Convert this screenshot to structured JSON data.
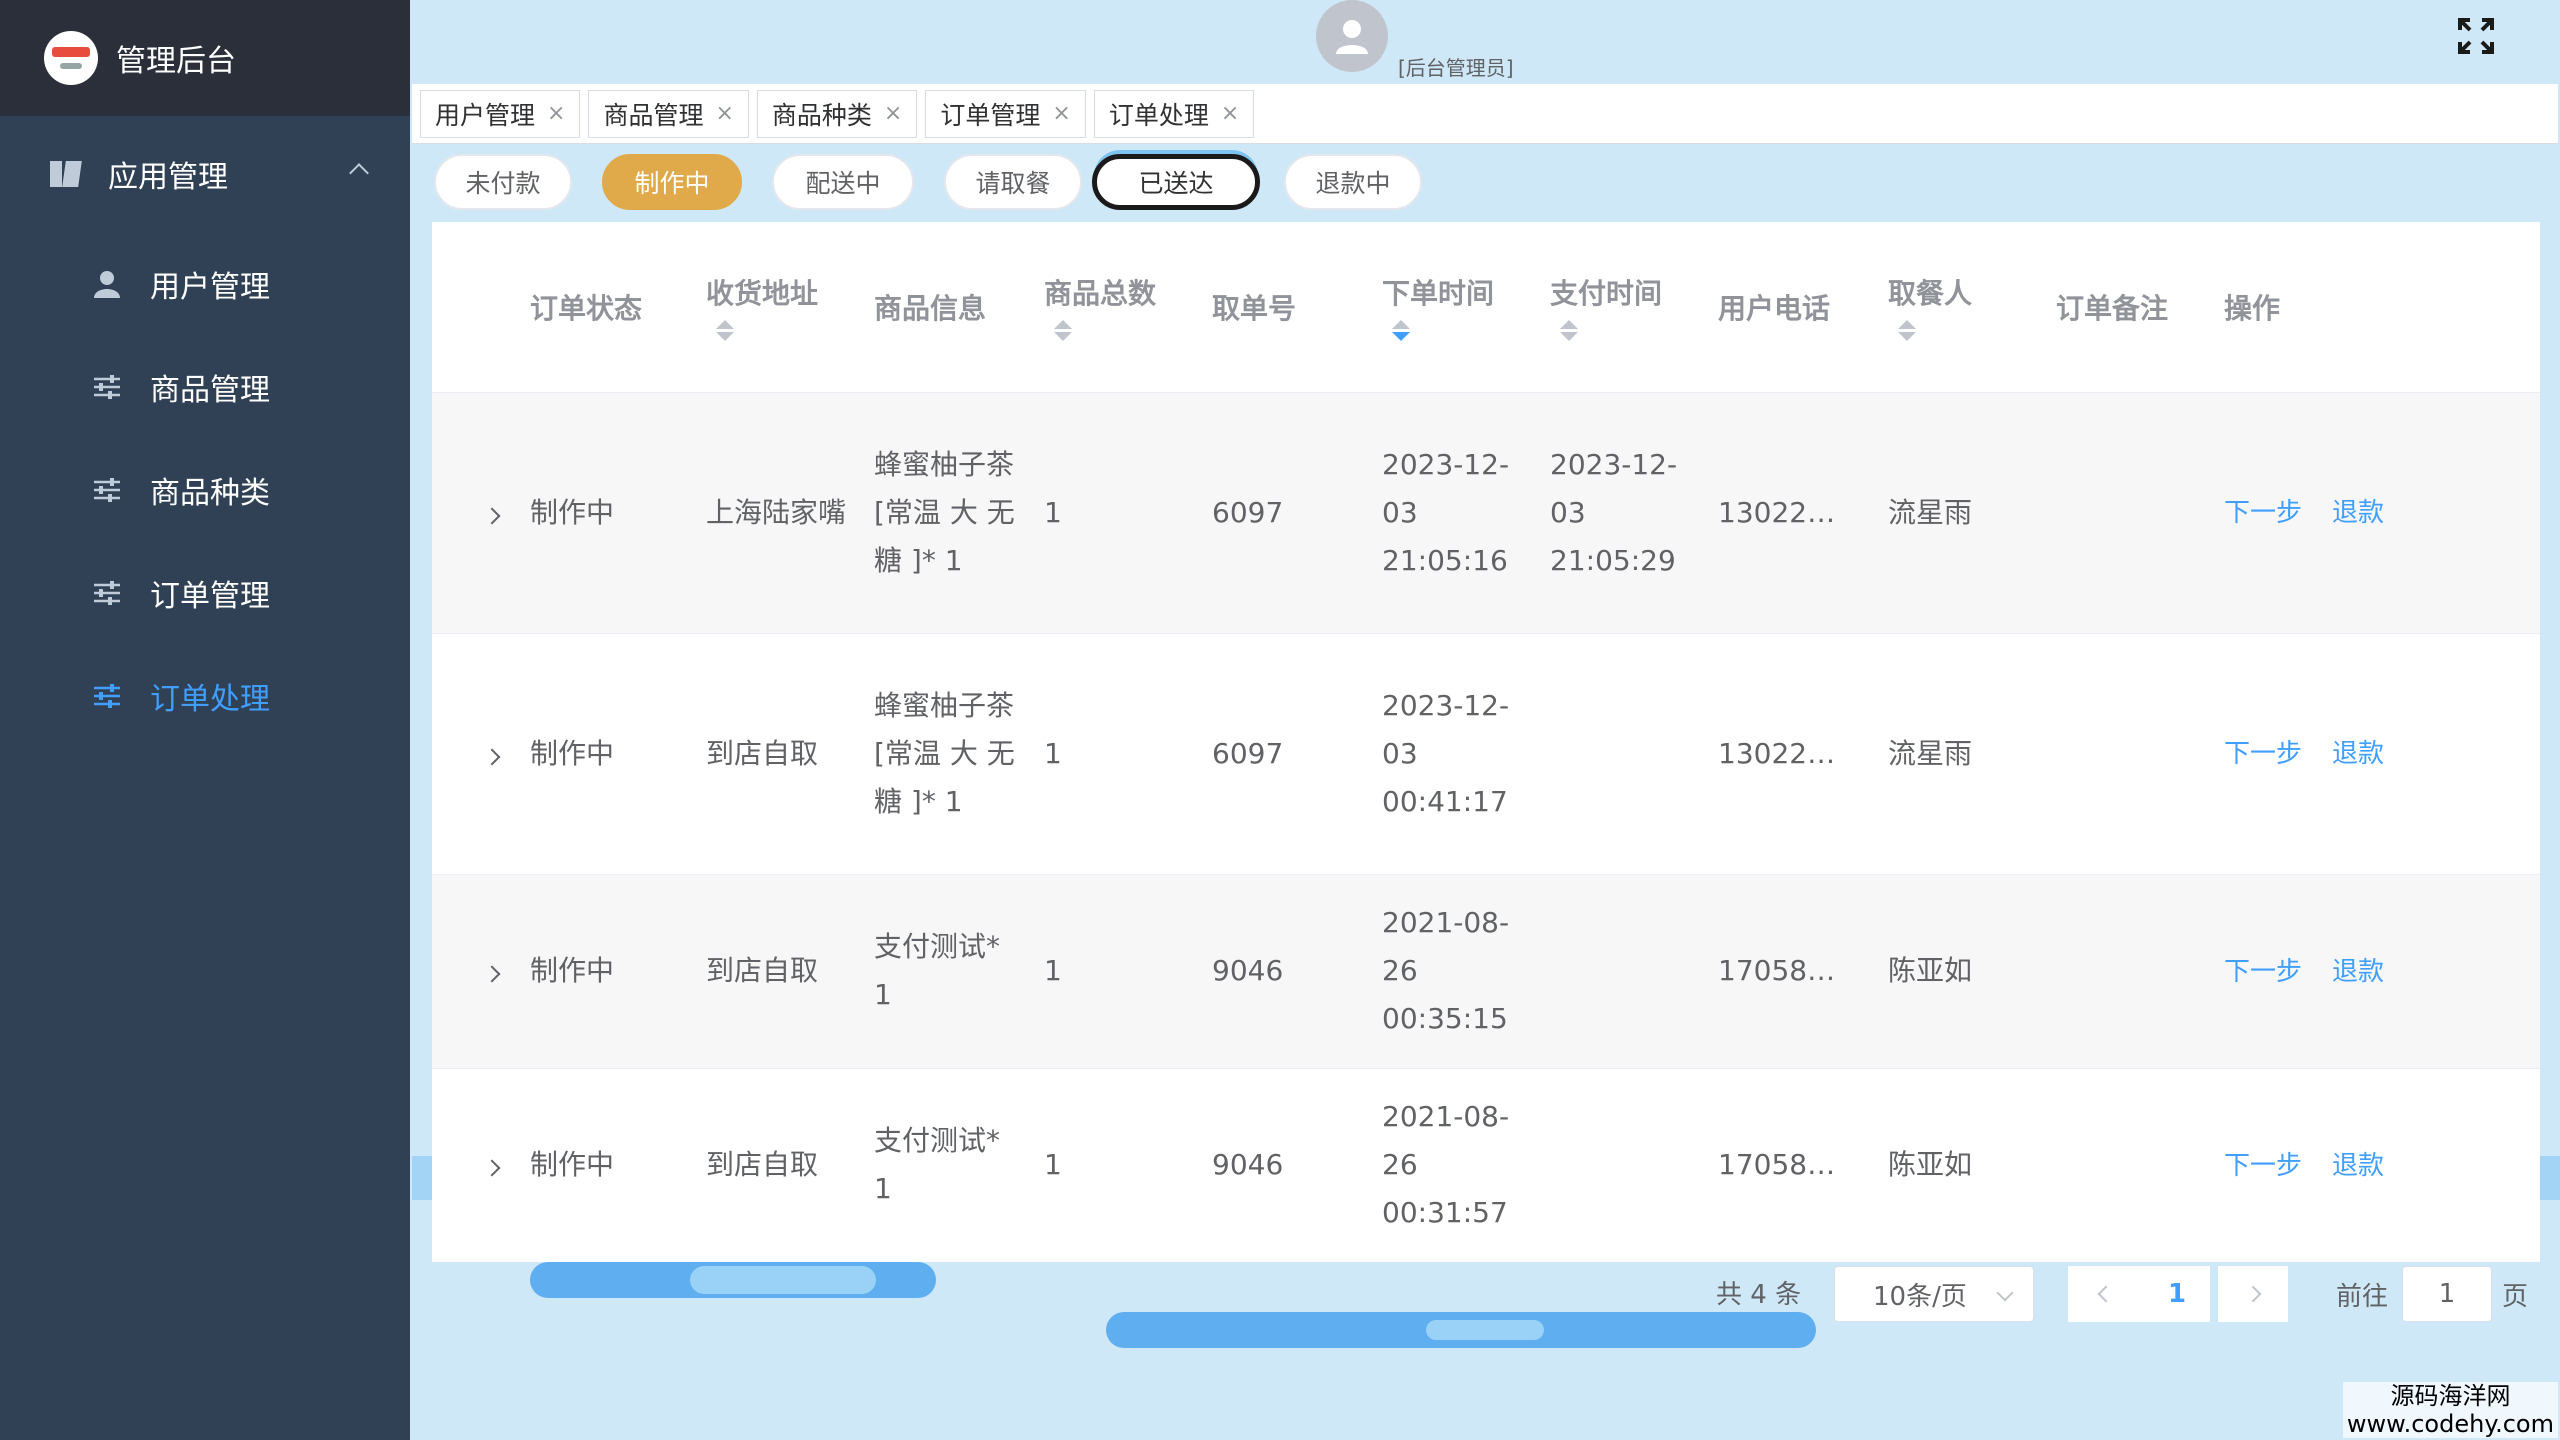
{
  "brand": {
    "title": "管理后台"
  },
  "sidebar": {
    "group": {
      "label": "应用管理",
      "icon": "app-icon"
    },
    "items": [
      {
        "label": "用户管理",
        "icon": "user-icon"
      },
      {
        "label": "商品管理",
        "icon": "sliders-icon"
      },
      {
        "label": "商品种类",
        "icon": "sliders-icon"
      },
      {
        "label": "订单管理",
        "icon": "sliders-icon"
      },
      {
        "label": "订单处理",
        "icon": "sliders-icon",
        "active": true
      }
    ]
  },
  "header": {
    "role": "[后台管理员]"
  },
  "tags": [
    {
      "label": "用户管理"
    },
    {
      "label": "商品管理"
    },
    {
      "label": "商品种类"
    },
    {
      "label": "订单管理"
    },
    {
      "label": "订单处理"
    }
  ],
  "status_filters": [
    {
      "label": "未付款"
    },
    {
      "label": "制作中",
      "active": true
    },
    {
      "label": "配送中"
    },
    {
      "label": "请取餐"
    },
    {
      "label": "已送达"
    },
    {
      "label": "退款中"
    }
  ],
  "table": {
    "columns": [
      {
        "label": ""
      },
      {
        "label": "订单状态"
      },
      {
        "label": "收货地址",
        "sortable": true
      },
      {
        "label": "商品信息"
      },
      {
        "label": "商品总数",
        "sortable": true
      },
      {
        "label": "取单号"
      },
      {
        "label": "下单时间",
        "sortable": true,
        "sort": "desc"
      },
      {
        "label": "支付时间",
        "sortable": true
      },
      {
        "label": "用户电话"
      },
      {
        "label": "取餐人",
        "sortable": true
      },
      {
        "label": "订单备注"
      },
      {
        "label": "操作"
      }
    ],
    "rows": [
      {
        "status": "制作中",
        "address": "上海陆家嘴",
        "goods": "蜂蜜柚子茶[常温 大 无糖 ]* 1",
        "total": "1",
        "pickup_no": "6097",
        "order_time": "2023-12-03 21:05:16",
        "pay_time": "2023-12-03 21:05:29",
        "phone": "13022…",
        "receiver": "流星雨",
        "remark": ""
      },
      {
        "status": "制作中",
        "address": "到店自取",
        "goods": "蜂蜜柚子茶[常温 大 无糖 ]* 1",
        "total": "1",
        "pickup_no": "6097",
        "order_time": "2023-12-03 00:41:17",
        "pay_time": "",
        "phone": "13022…",
        "receiver": "流星雨",
        "remark": ""
      },
      {
        "status": "制作中",
        "address": "到店自取",
        "goods": "支付测试* 1",
        "total": "1",
        "pickup_no": "9046",
        "order_time": "2021-08-26 00:35:15",
        "pay_time": "",
        "phone": "17058…",
        "receiver": "陈亚如",
        "remark": ""
      },
      {
        "status": "制作中",
        "address": "到店自取",
        "goods": "支付测试* 1",
        "total": "1",
        "pickup_no": "9046",
        "order_time": "2021-08-26 00:31:57",
        "pay_time": "",
        "phone": "17058…",
        "receiver": "陈亚如",
        "remark": ""
      }
    ],
    "actions": {
      "next": "下一步",
      "refund": "退款"
    }
  },
  "pagination": {
    "total": "共 4 条",
    "page_size": "10条/页",
    "current_page": "1",
    "jump_label": "前往",
    "jump_value": "1",
    "jump_suffix": "页"
  },
  "watermark": {
    "line1": "源码海洋网",
    "line2": "www.codehy.com"
  },
  "colors": {
    "sidebar": "#304156",
    "active": "#409eff",
    "pill_active": "#e0a94a"
  }
}
